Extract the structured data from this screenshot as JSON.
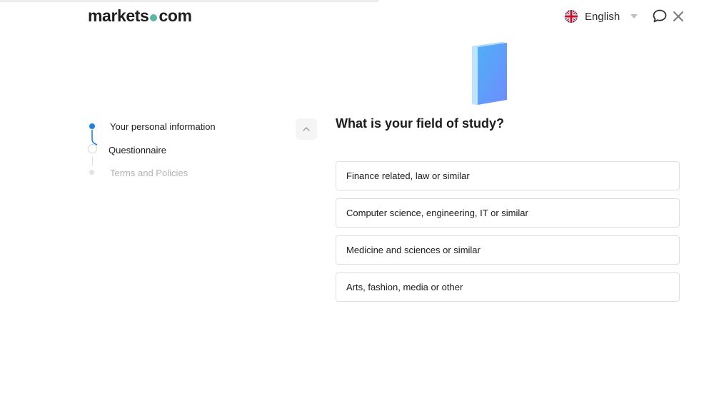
{
  "header": {
    "logo_left": "markets",
    "logo_right": "com",
    "language": {
      "label": "English",
      "flag_icon": "uk-flag-icon"
    },
    "chat_icon": "chat-bubble-icon",
    "close_icon": "close-icon"
  },
  "stepper": {
    "steps": [
      {
        "label": "Your personal information",
        "state": "completed"
      },
      {
        "label": "Questionnaire",
        "state": "current"
      },
      {
        "label": "Terms and Policies",
        "state": "upcoming"
      }
    ],
    "collapse_icon": "chevron-up-icon"
  },
  "illustration": {
    "icon": "book-icon"
  },
  "question": {
    "title": "What is your field of study?",
    "options": [
      {
        "label": "Finance related, law or similar"
      },
      {
        "label": "Computer science, engineering, IT or similar"
      },
      {
        "label": "Medicine and sciences or similar"
      },
      {
        "label": "Arts, fashion, media or other"
      }
    ]
  },
  "colors": {
    "accent": "#1a82e6",
    "logo_dot": "#58b7a6",
    "book_gradient_start": "#4fb0f5",
    "book_gradient_end": "#6f8cff"
  }
}
